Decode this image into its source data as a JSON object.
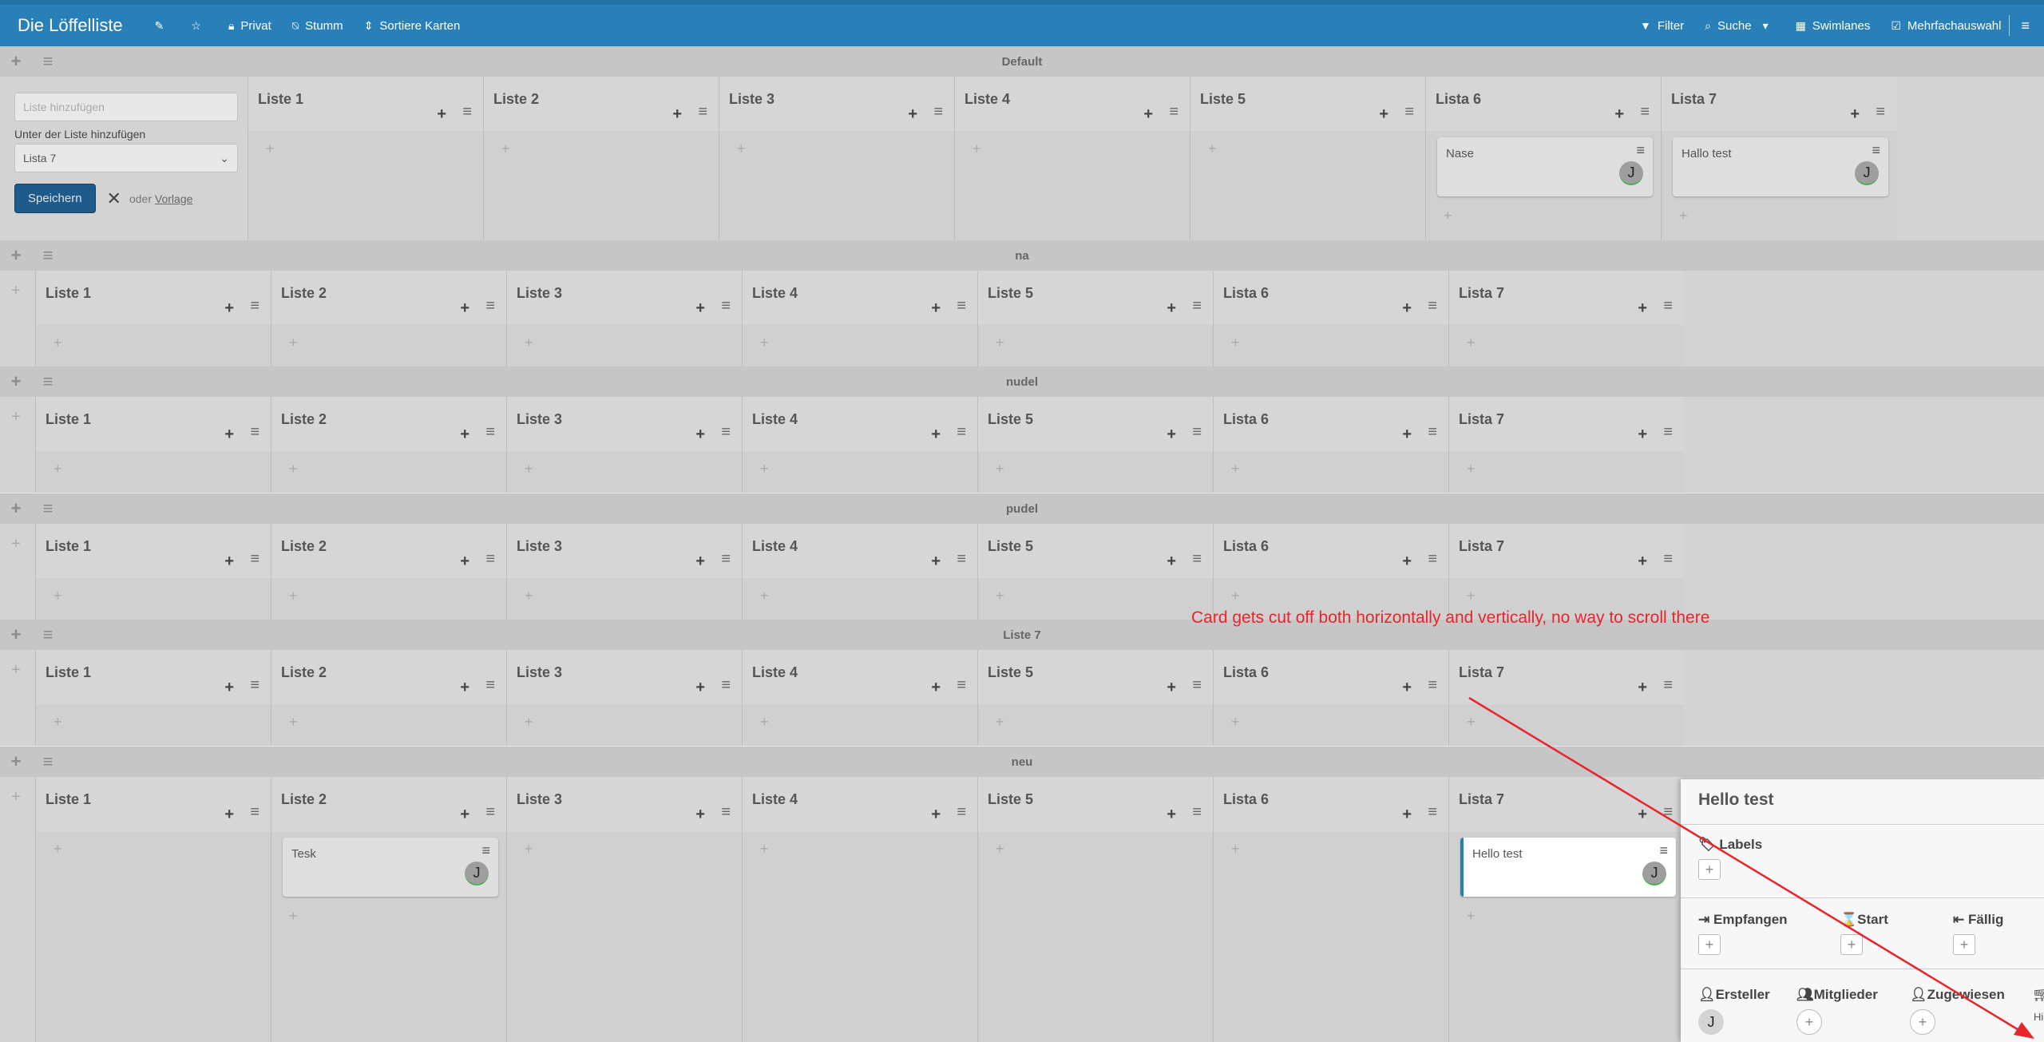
{
  "header": {
    "title": "Die Löffelliste",
    "privacy": "Privat",
    "mute": "Stumm",
    "sort": "Sortiere Karten",
    "filter": "Filter",
    "search": "Suche",
    "swimlanes": "Swimlanes",
    "multiselect": "Mehrfachauswahl"
  },
  "addlist": {
    "placeholder": "Liste hinzufügen",
    "below_label": "Unter der Liste hinzufügen",
    "selected": "Lista 7",
    "save": "Speichern",
    "or": "oder",
    "template": "Vorlage"
  },
  "lists": [
    "Liste 1",
    "Liste 2",
    "Liste 3",
    "Liste 4",
    "Liste 5",
    "Lista 6",
    "Lista 7"
  ],
  "default_lists": [
    "Liste 1",
    "Liste 2",
    "Liste 3",
    "Liste 4",
    "Liste 5",
    "Lista 6",
    "Lista 7"
  ],
  "swimlanes": {
    "default": "Default",
    "na": "na",
    "nudel": "nudel",
    "pudel": "pudel",
    "liste7": "Liste 7",
    "neu": "neu"
  },
  "cards": {
    "nase": "Nase",
    "hallo": "Hallo test",
    "tesk": "Tesk",
    "hello": "Hello test",
    "avatar": "J"
  },
  "detail": {
    "title": "Hello test",
    "labels": "Labels",
    "received": "Empfangen",
    "start": "Start",
    "due": "Fällig",
    "creator": "Ersteller",
    "members": "Mitglieder",
    "assigned": "Zugewiesen",
    "avatar": "J",
    "cut": "Hi"
  },
  "annotation": "Card gets cut off both horizontally and vertically, no way to scroll there",
  "colors": {
    "header": "#2980b9",
    "annotation": "#e8242c"
  }
}
